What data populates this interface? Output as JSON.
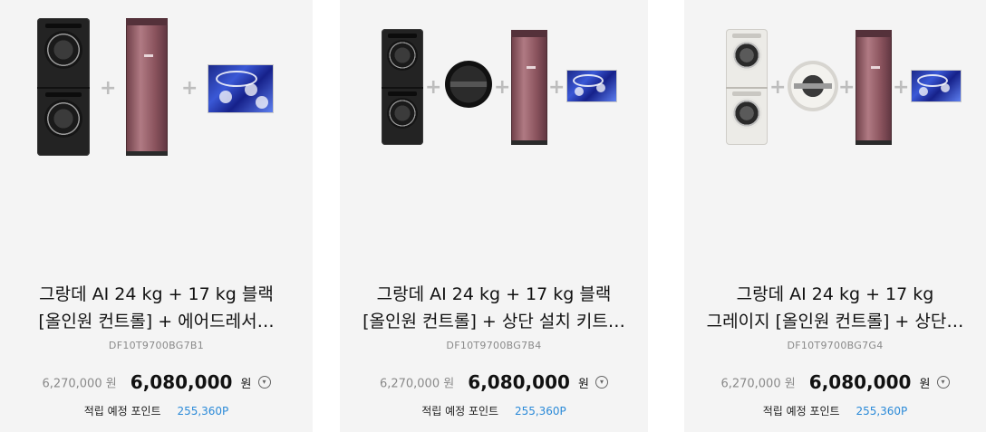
{
  "products": [
    {
      "title_line1": "그랑데 AI 24 kg + 17 kg 블랙",
      "title_line2": "[올인원 컨트롤] + 에어드레서…",
      "model": "DF10T9700BG7B1",
      "original_price": "6,270,000 원",
      "sale_price": "6,080,000",
      "currency": "원",
      "points_label": "적립 예정 포인트",
      "points_value": "255,360P",
      "image_components": [
        "washer-dryer-stack-black-icon",
        "plus-icon",
        "airdresser-icon",
        "plus-icon",
        "dress-sheet-icon"
      ]
    },
    {
      "title_line1": "그랑데 AI 24 kg + 17 kg 블랙",
      "title_line2": "[올인원 컨트롤] + 상단 설치 키트…",
      "model": "DF10T9700BG7B4",
      "original_price": "6,270,000 원",
      "sale_price": "6,080,000",
      "currency": "원",
      "points_label": "적립 예정 포인트",
      "points_value": "255,360P",
      "image_components": [
        "washer-dryer-stack-black-icon",
        "plus-icon",
        "install-kit-icon",
        "plus-icon",
        "airdresser-icon",
        "plus-icon",
        "dress-sheet-icon"
      ]
    },
    {
      "title_line1": "그랑데 AI 24 kg + 17 kg",
      "title_line2": "그레이지 [올인원 컨트롤] + 상단…",
      "model": "DF10T9700BG7G4",
      "original_price": "6,270,000 원",
      "sale_price": "6,080,000",
      "currency": "원",
      "points_label": "적립 예정 포인트",
      "points_value": "255,360P",
      "image_components": [
        "washer-dryer-stack-white-icon",
        "plus-icon",
        "install-kit-icon",
        "plus-icon",
        "airdresser-icon",
        "plus-icon",
        "dress-sheet-icon"
      ]
    }
  ],
  "colors": {
    "card_bg": "#f4f4f4",
    "points_blue": "#2b8ad8",
    "text_main": "#111111",
    "text_muted": "#8a8a8a"
  }
}
